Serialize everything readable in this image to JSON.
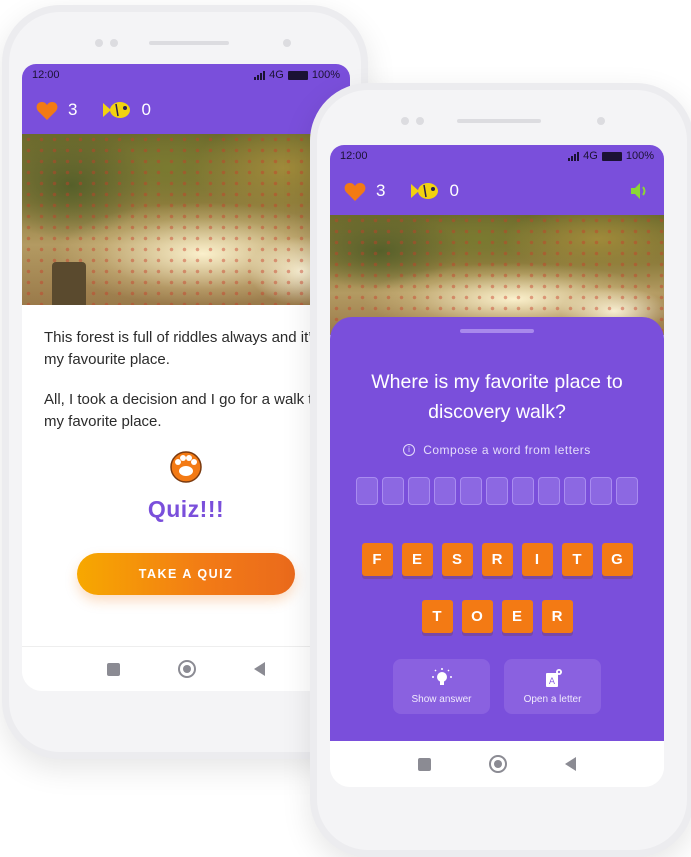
{
  "status": {
    "time": "12:00",
    "network": "4G",
    "battery": "100%"
  },
  "header": {
    "lives": "3",
    "coins": "0"
  },
  "story": {
    "paragraphs": [
      "This forest is full of riddles always and it’s my favourite place.",
      "All, I took a decision and I go for a walk to my favorite place."
    ],
    "quiz_title": "Quiz!!!",
    "cta_label": "TAKE A QUIZ"
  },
  "quiz": {
    "question": "Where is my favorite place to discovery walk?",
    "hint": "Compose a word from letters",
    "slot_count": 11,
    "letters_row1": [
      "F",
      "E",
      "S",
      "R",
      "I",
      "T",
      "G"
    ],
    "letters_row2": [
      "T",
      "O",
      "E",
      "R"
    ],
    "show_answer_label": "Show answer",
    "open_letter_label": "Open a letter"
  },
  "colors": {
    "primary": "#7a4fdb",
    "accent": "#f37a14",
    "sound": "#8bd635"
  },
  "icons": [
    "heart-icon",
    "fish-icon",
    "speaker-icon",
    "paw-icon",
    "lightbulb-icon",
    "letter-icon",
    "info-icon"
  ]
}
